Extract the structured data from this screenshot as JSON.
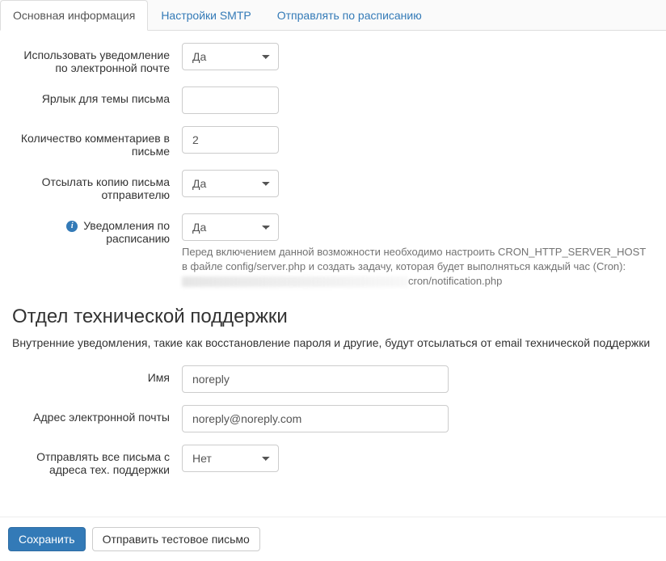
{
  "tabs": {
    "basic": "Основная информация",
    "smtp": "Настройки SMTP",
    "schedule": "Отправлять по расписанию"
  },
  "fields": {
    "use_email_notif": {
      "label": "Использовать уведомление по электронной почте",
      "value": "Да"
    },
    "subject_label": {
      "label": "Ярлык для темы письма",
      "value": ""
    },
    "comments_count": {
      "label": "Количество комментариев в письме",
      "value": "2"
    },
    "send_copy": {
      "label": "Отсылать копию письма отправителю",
      "value": "Да"
    },
    "schedule_notif": {
      "label": "Уведомления по расписанию",
      "value": "Да",
      "help1": "Перед включением данной возможности необходимо настроить CRON_HTTP_SERVER_HOST в файле config/server.php и создать задачу, которая будет выполняться каждый час (Cron):",
      "help2": "cron/notification.php"
    }
  },
  "section": {
    "heading": "Отдел технической поддержки",
    "desc": "Внутренние уведомления, такие как восстановление пароля и другие, будут отсылаться от email технической поддержки"
  },
  "support": {
    "name": {
      "label": "Имя",
      "value": "noreply"
    },
    "email": {
      "label": "Адрес электронной почты",
      "value": "noreply@noreply.com"
    },
    "send_all": {
      "label": "Отправлять все письма с адреса тех. поддержки",
      "value": "Нет"
    }
  },
  "buttons": {
    "save": "Сохранить",
    "test": "Отправить тестовое письмо"
  }
}
